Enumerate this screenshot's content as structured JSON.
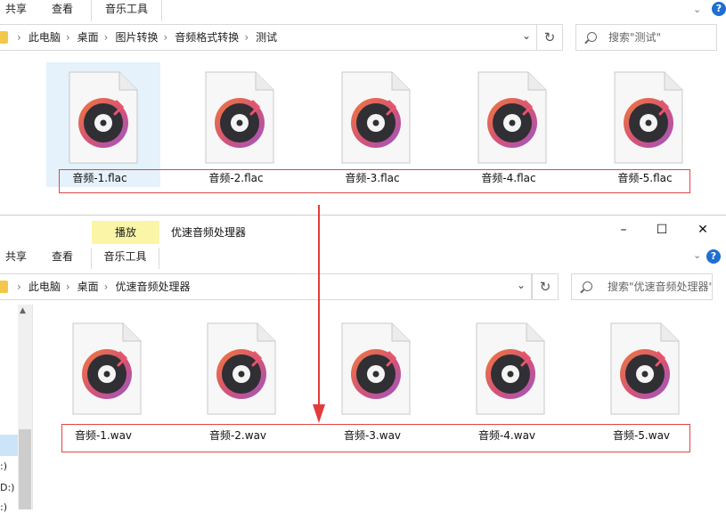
{
  "top_window": {
    "ribbon_tabs": [
      "共享",
      "查看",
      "音乐工具"
    ],
    "breadcrumbs": [
      "此电脑",
      "桌面",
      "图片转换",
      "音频格式转换",
      "测试"
    ],
    "search_placeholder": "搜索\"测试\"",
    "files": [
      "音频-1.flac",
      "音频-2.flac",
      "音频-3.flac",
      "音频-4.flac",
      "音频-5.flac"
    ]
  },
  "bottom_window": {
    "title": "优速音频处理器",
    "context_tab": "播放",
    "ribbon_tabs": [
      "共享",
      "查看",
      "音乐工具"
    ],
    "breadcrumbs": [
      "此电脑",
      "桌面",
      "优速音频处理器"
    ],
    "search_placeholder": "搜索\"优速音频处理器\"",
    "files": [
      "音频-1.wav",
      "音频-2.wav",
      "音频-3.wav",
      "音频-4.wav",
      "音频-5.wav"
    ],
    "drives": [
      ":)",
      "D:)",
      ":)"
    ]
  },
  "colors": {
    "selection": "#e5f1fb",
    "highlight_box": "#e04545",
    "arrow": "#e23b3b",
    "context_tab_bg": "#fbf5a8",
    "help": "#1f6fd1"
  },
  "icons": [
    "music-file-icon",
    "folder-icon",
    "search-icon",
    "refresh-icon",
    "help-icon"
  ]
}
